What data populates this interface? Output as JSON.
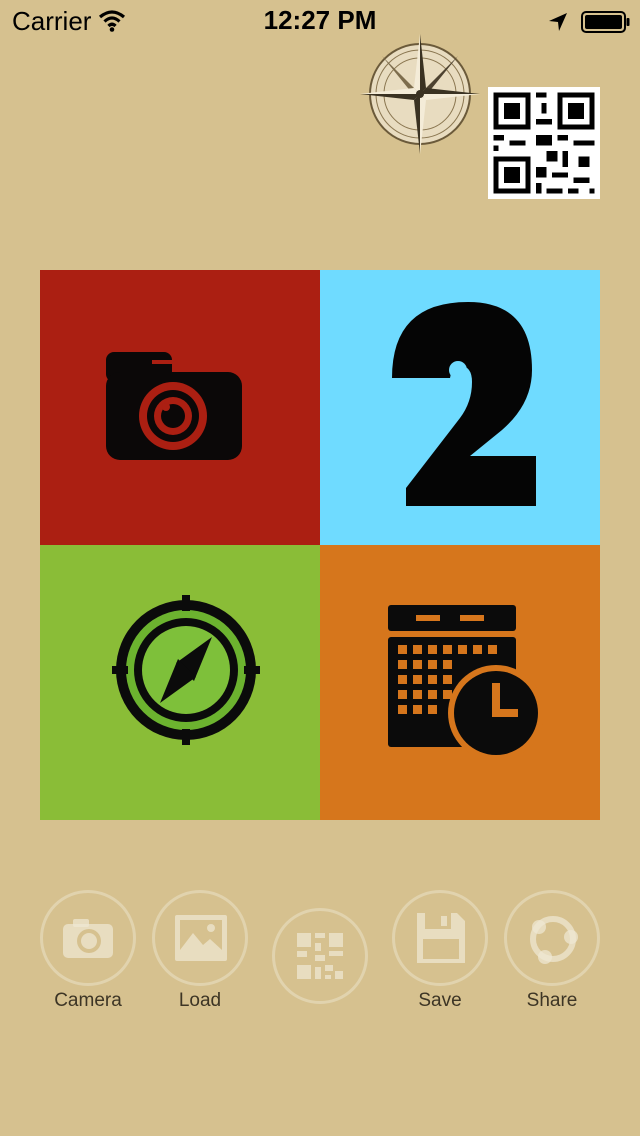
{
  "status_bar": {
    "carrier": "Carrier",
    "time": "12:27 PM"
  },
  "toolbar": {
    "camera_label": "Camera",
    "load_label": "Load",
    "save_label": "Save",
    "share_label": "Share"
  },
  "colors": {
    "background": "#d6c18f",
    "tile_camera": "#ab1f12",
    "tile_two": "#6fdbff",
    "tile_compass": "#8abd37",
    "tile_calendar": "#d6761c"
  }
}
